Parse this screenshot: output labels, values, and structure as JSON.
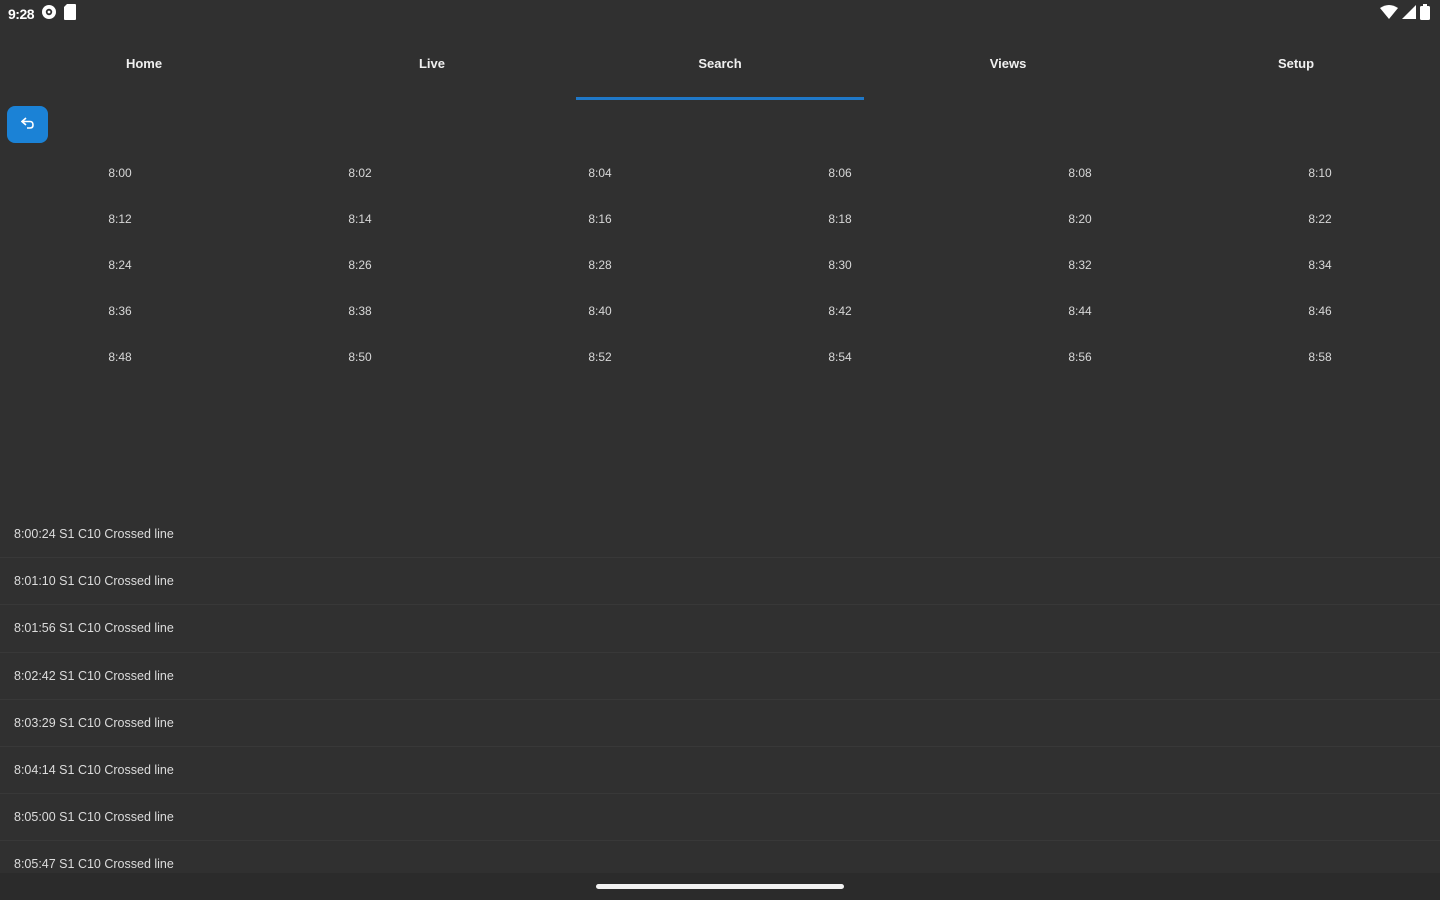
{
  "status_bar": {
    "time": "9:28",
    "icons": [
      "settings-gear-icon",
      "sd-card-icon",
      "wifi-icon",
      "cell-signal-icon",
      "battery-icon"
    ]
  },
  "tabs": [
    {
      "label": "Home",
      "active": false
    },
    {
      "label": "Live",
      "active": false
    },
    {
      "label": "Search",
      "active": true
    },
    {
      "label": "Views",
      "active": false
    },
    {
      "label": "Setup",
      "active": false
    }
  ],
  "back_button": {
    "icon": "back-arrow-icon"
  },
  "time_slots": [
    "8:00",
    "8:02",
    "8:04",
    "8:06",
    "8:08",
    "8:10",
    "8:12",
    "8:14",
    "8:16",
    "8:18",
    "8:20",
    "8:22",
    "8:24",
    "8:26",
    "8:28",
    "8:30",
    "8:32",
    "8:34",
    "8:36",
    "8:38",
    "8:40",
    "8:42",
    "8:44",
    "8:46",
    "8:48",
    "8:50",
    "8:52",
    "8:54",
    "8:56",
    "8:58"
  ],
  "events": [
    "8:00:24 S1 C10 Crossed line",
    "8:01:10 S1 C10 Crossed line",
    "8:01:56 S1 C10 Crossed line",
    "8:02:42 S1 C10 Crossed line",
    "8:03:29 S1 C10 Crossed line",
    "8:04:14 S1 C10 Crossed line",
    "8:05:00 S1 C10 Crossed line",
    "8:05:47 S1 C10 Crossed line"
  ],
  "colors": {
    "background": "#303030",
    "accent": "#1f78c8",
    "back_button": "#1b82d6"
  }
}
